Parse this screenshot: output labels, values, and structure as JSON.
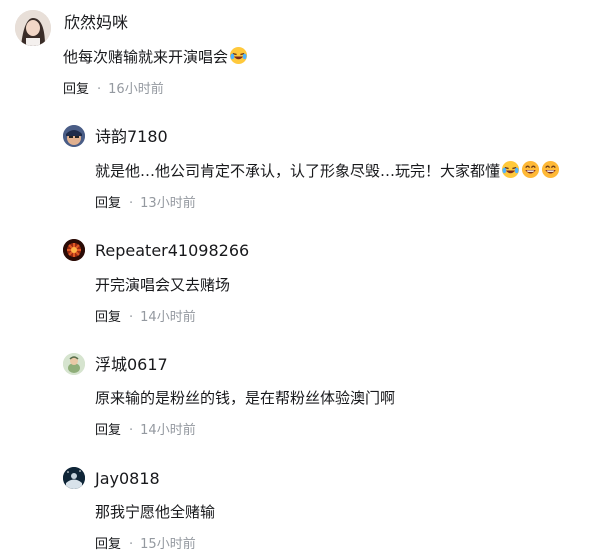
{
  "main_comment": {
    "username": "欣然妈咪",
    "content": "他每次赌输就来开演唱会",
    "emojis": [
      "laughing-tears-icon"
    ],
    "reply_label": "回复",
    "time": "16小时前"
  },
  "replies": [
    {
      "username": "诗韵7180",
      "content": "就是他…他公司肯定不承认，认了形象尽毁…玩完！大家都懂",
      "emojis": [
        "laughing-tears-icon",
        "grin-icon",
        "grin-icon"
      ],
      "reply_label": "回复",
      "time": "13小时前"
    },
    {
      "username": "Repeater41098266",
      "content": "开完演唱会又去赌场",
      "reply_label": "回复",
      "time": "14小时前"
    },
    {
      "username": "浮城0617",
      "content": "原来输的是粉丝的钱，是在帮粉丝体验澳门啊",
      "reply_label": "回复",
      "time": "14小时前"
    },
    {
      "username": "Jay0818",
      "content": "那我宁愿他全赌输",
      "reply_label": "回复",
      "time": "15小时前"
    }
  ],
  "separator": "·",
  "colors": {
    "text": "#18191c",
    "muted": "#9499a0",
    "emoji_face": "#ffc93c"
  }
}
